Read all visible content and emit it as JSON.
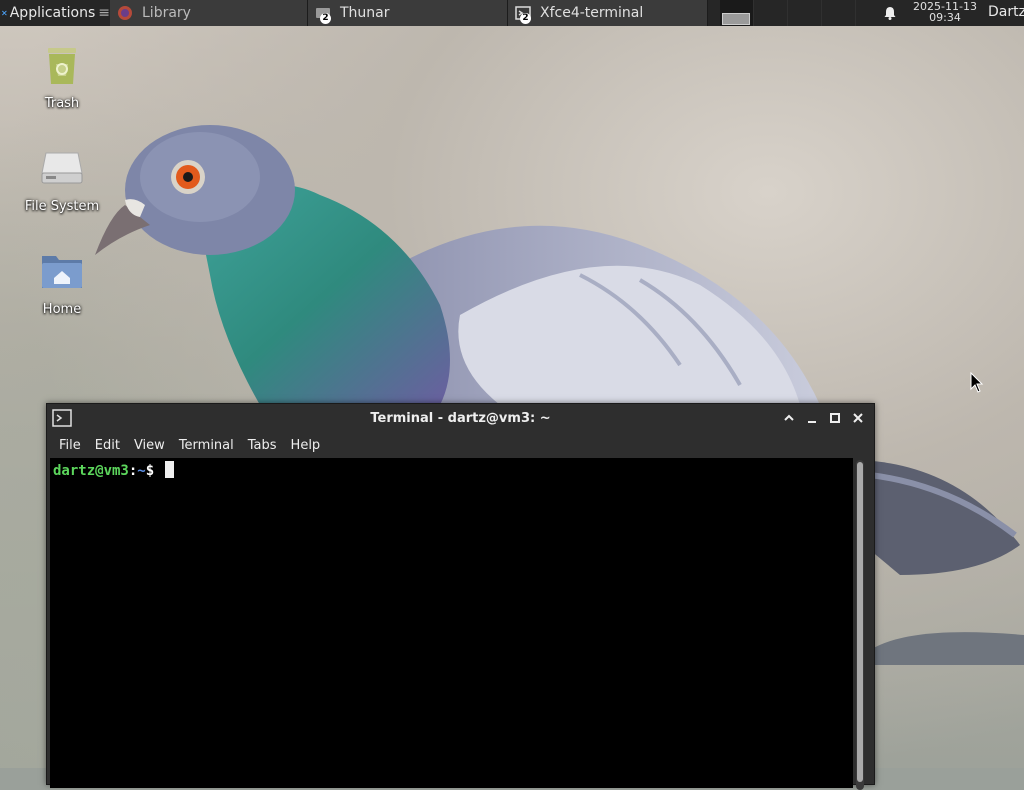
{
  "panel": {
    "applications_label": "Applications",
    "tasks": [
      {
        "label": "Library",
        "icon": "firefox-icon"
      },
      {
        "label": "Thunar",
        "icon": "file-manager-icon",
        "badge": "2"
      },
      {
        "label": "Xfce4-terminal",
        "icon": "terminal-icon",
        "badge": "2"
      }
    ],
    "clock_date": "2025-11-13",
    "clock_time": "09:34",
    "user": "Dartz"
  },
  "desktop": {
    "icons": [
      {
        "label": "Trash",
        "icon": "trash-icon"
      },
      {
        "label": "File System",
        "icon": "drive-icon"
      },
      {
        "label": "Home",
        "icon": "home-folder-icon"
      }
    ]
  },
  "terminal": {
    "title": "Terminal - dartz@vm3: ~",
    "menu": [
      "File",
      "Edit",
      "View",
      "Terminal",
      "Tabs",
      "Help"
    ],
    "prompt_user": "dartz@vm3",
    "prompt_sep": ":",
    "prompt_path": "~",
    "prompt_symbol": "$ "
  },
  "colors": {
    "panel_bg": "#262626",
    "prompt_user": "#5cd65c",
    "prompt_path": "#5c8fe6",
    "terminal_bg": "#000000"
  }
}
